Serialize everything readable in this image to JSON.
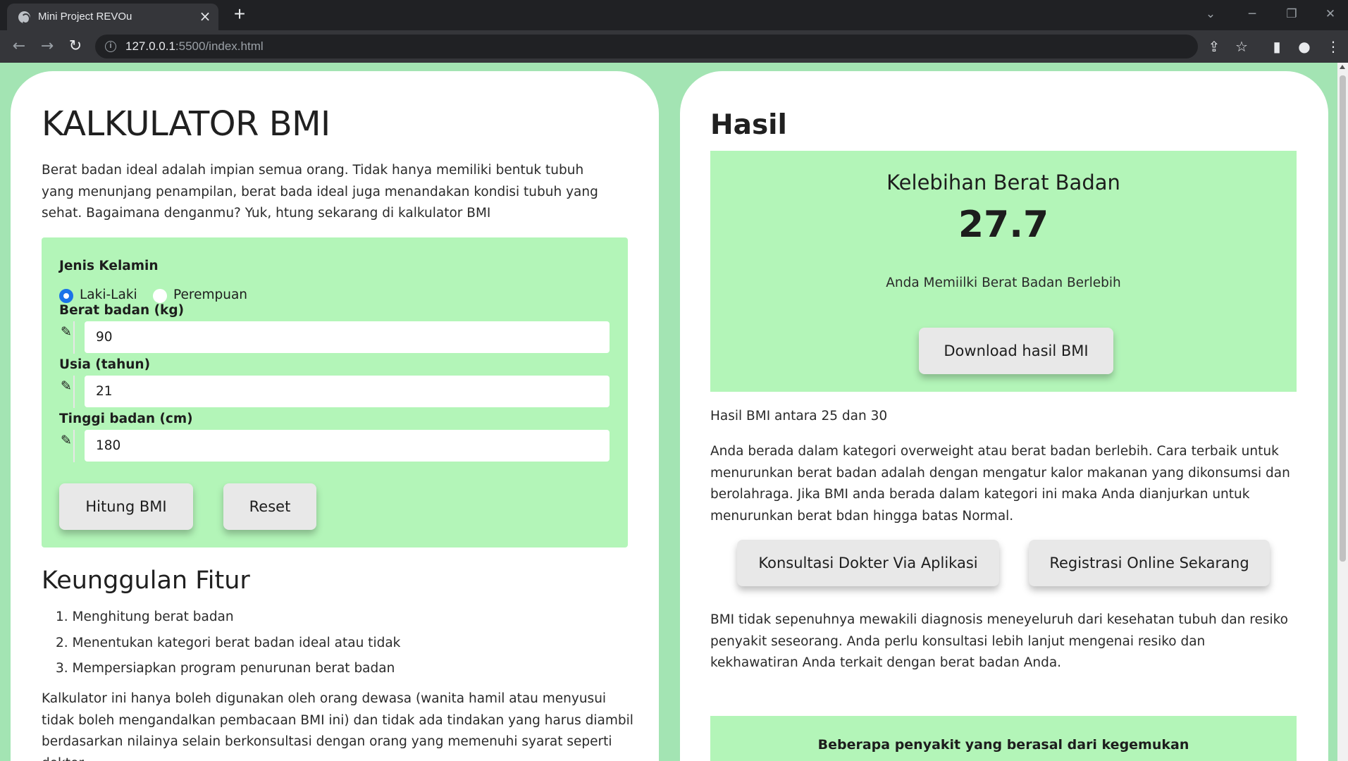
{
  "browser": {
    "tab_title": "Mini Project REVOu",
    "url_host": "127.0.0.1",
    "url_rest": ":5500/index.html"
  },
  "calculator": {
    "title": "KALKULATOR BMI",
    "intro": "Berat badan ideal adalah impian semua orang. Tidak hanya memiliki bentuk tubuh yang menunjang penampilan, berat bada ideal juga menandakan kondisi tubuh yang sehat. Bagaimana denganmu? Yuk, htung sekarang di kalkulator BMI",
    "form": {
      "gender_label": "Jenis Kelamin",
      "gender_options": [
        "Laki-Laki",
        "Perempuan"
      ],
      "gender_selected": "Laki-Laki",
      "weight_label": "Berat badan (kg)",
      "weight_value": "90",
      "age_label": "Usia (tahun)",
      "age_value": "21",
      "height_label": "Tinggi badan (cm)",
      "height_value": "180",
      "calc_button": "Hitung BMI",
      "reset_button": "Reset"
    }
  },
  "features": {
    "title": "Keunggulan Fitur",
    "items": [
      "1. Menghitung berat badan",
      "2. Menentukan kategori berat badan ideal atau tidak",
      "3. Mempersiapkan program penurunan berat badan"
    ],
    "disclaimer": "Kalkulator ini hanya boleh digunakan oleh orang dewasa (wanita hamil atau menyusui tidak boleh mengandalkan pembacaan BMI ini) dan tidak ada tindakan yang harus diambil berdasarkan nilainya selain berkonsultasi dengan orang yang memenuhi syarat seperti dokter."
  },
  "result": {
    "title": "Hasil",
    "category": "Kelebihan Berat Badan",
    "bmi_value": "27.7",
    "description": "Anda Memiilki Berat Badan Berlebih",
    "download_button": "Download hasil BMI",
    "range_text": "Hasil BMI antara 25 dan 30",
    "advice": "Anda berada dalam kategori overweight atau berat badan berlebih. Cara terbaik untuk menurunkan berat badan adalah dengan mengatur kalor makanan yang dikonsumsi dan berolahraga. Jika BMI anda berada dalam kategori ini maka Anda dianjurkan untuk menurunkan berat bdan hingga batas Normal.",
    "consult_button": "Konsultasi Dokter Via Aplikasi",
    "register_button": "Registrasi Online Sekarang",
    "note": "BMI tidak sepenuhnya mewakili diagnosis meneyeluruh dari kesehatan tubuh dan resiko penyakit seseorang. Anda perlu konsultasi lebih lanjut mengenai resiko dan kekhawatiran Anda terkait dengan berat badan Anda.",
    "disease_title": "Beberapa penyakit yang berasal dari kegemukan"
  },
  "colors": {
    "page_bg": "#a3e4b3",
    "panel_bg": "#b3f5b8",
    "radio_accent": "#1a73e8"
  }
}
